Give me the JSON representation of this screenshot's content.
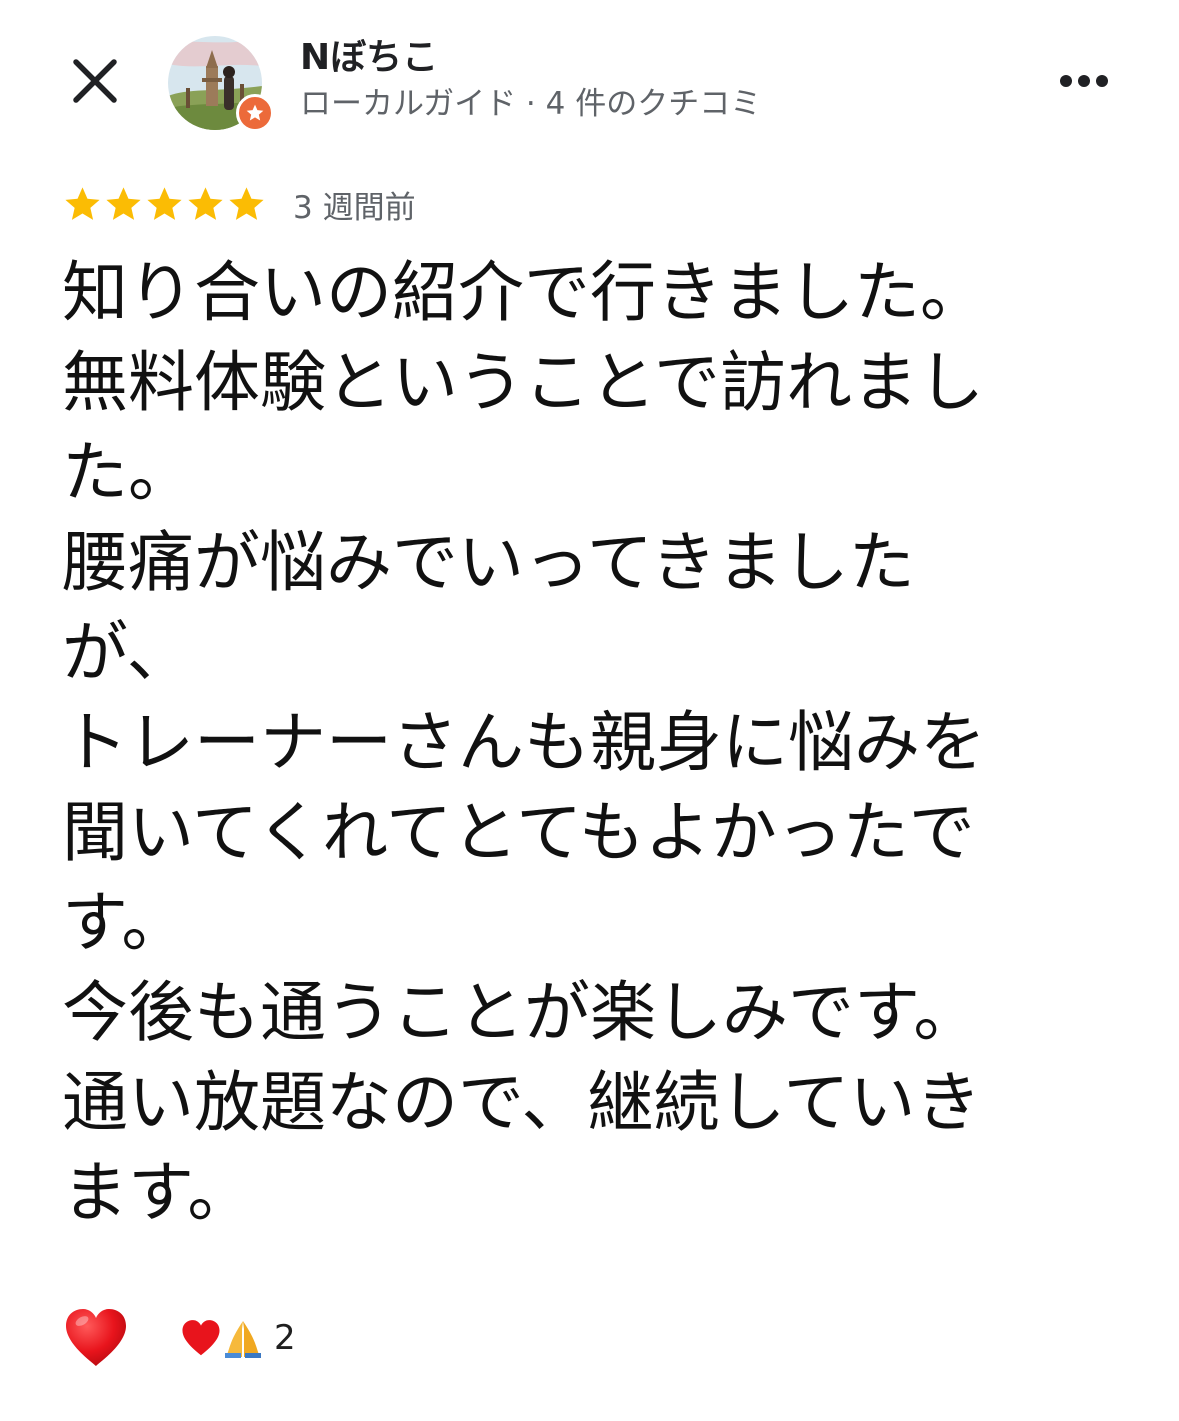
{
  "header": {
    "close_icon": "close-icon",
    "author": {
      "name": "Nぼちこ",
      "meta": "ローカルガイド · 4 件のクチコミ",
      "badge_icon": "local-guide-star-icon",
      "badge_color": "#ec6a3a"
    },
    "more_icon": "more-horizontal-icon"
  },
  "review": {
    "rating": 5,
    "max_rating": 5,
    "star_color": "#fbbc04",
    "time": "3 週間前",
    "lines": [
      "知り合いの紹介で行きました。",
      "無料体験ということで訪れまし",
      "た。",
      "腰痛が悩みでいってきました",
      "が、",
      "トレーナーさんも親身に悩みを",
      "聞いてくれてとてもよかったで",
      "す。",
      "今後も通うことが楽しみです。",
      "通い放題なので、継続していき",
      "ます。"
    ]
  },
  "reactions": {
    "react_icon": "heart-icon",
    "summary_icons": [
      "heart-icon",
      "folded-hands-icon"
    ],
    "count": "2"
  }
}
